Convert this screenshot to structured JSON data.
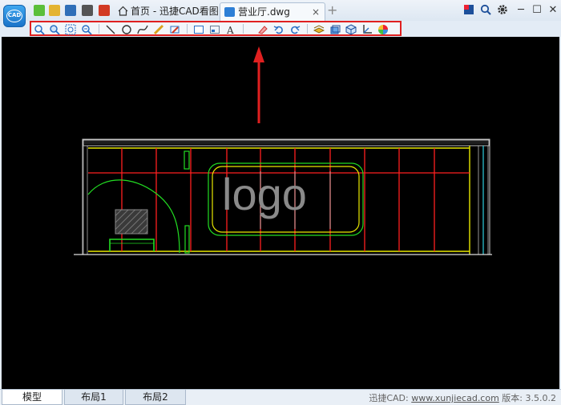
{
  "titlebar": {
    "home_tab_label": "首页 - 迅捷CAD看图",
    "file_tab_label": "营业厅.dwg",
    "close_glyph": "×",
    "add_tab_glyph": "+",
    "window_controls": {
      "minimize": "─",
      "maximize": "☐",
      "close": "✕"
    }
  },
  "logo": {
    "text": "CAD"
  },
  "toolbar": {
    "icons": [
      "zoom-pan-icon",
      "zoom-window-icon",
      "zoom-extents-icon",
      "zoom-previous-icon",
      "line-icon",
      "circle-icon",
      "polyline-icon",
      "measure-icon",
      "edit-pen-icon",
      "frame-icon",
      "layout-icon",
      "text-icon",
      "eraser-icon",
      "undo-icon",
      "redo-icon",
      "layers-icon",
      "block-icon",
      "3d-view-icon",
      "coordinate-icon",
      "color-icon"
    ]
  },
  "drawing": {
    "logo_text": "logo"
  },
  "bottom": {
    "tabs": [
      "模型",
      "布局1",
      "布局2"
    ],
    "status_prefix": "迅捷CAD: ",
    "status_link": "www.xunjiecad.com",
    "status_version": " 版本: 3.5.0.2"
  },
  "colors": {
    "accent_red": "#e02020",
    "canvas_bg": "#000000",
    "wall_red": "#ff2020",
    "frame_yellow": "#e8e800",
    "line_green": "#22dd22"
  }
}
